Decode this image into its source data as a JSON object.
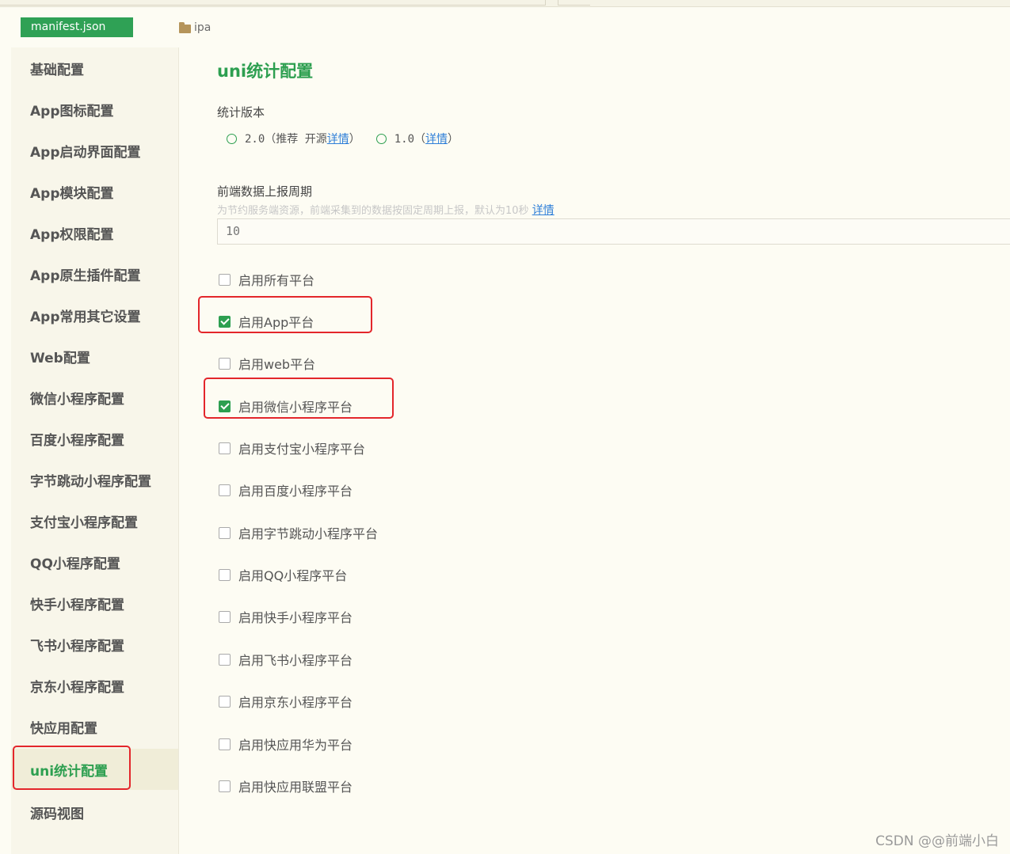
{
  "editor": {
    "file_tab": "manifest.json",
    "breadcrumb_folder": "ipa"
  },
  "sidebar": {
    "items": [
      {
        "label": "基础配置"
      },
      {
        "label": "App图标配置"
      },
      {
        "label": "App启动界面配置"
      },
      {
        "label": "App模块配置"
      },
      {
        "label": "App权限配置"
      },
      {
        "label": "App原生插件配置"
      },
      {
        "label": "App常用其它设置"
      },
      {
        "label": "Web配置"
      },
      {
        "label": "微信小程序配置"
      },
      {
        "label": "百度小程序配置"
      },
      {
        "label": "字节跳动小程序配置"
      },
      {
        "label": "支付宝小程序配置"
      },
      {
        "label": "QQ小程序配置"
      },
      {
        "label": "快手小程序配置"
      },
      {
        "label": "飞书小程序配置"
      },
      {
        "label": "京东小程序配置"
      },
      {
        "label": "快应用配置"
      },
      {
        "label": "uni统计配置"
      },
      {
        "label": "源码视图"
      }
    ],
    "active_index": 17
  },
  "main": {
    "title": "uni统计配置",
    "version": {
      "label": "统计版本",
      "opt1_text": "2.0（推荐 开源 ",
      "opt1_link": "详情",
      "opt1_close": "）",
      "opt2_text": "1.0（",
      "opt2_link": "详情",
      "opt2_close": "）"
    },
    "report": {
      "label": "前端数据上报周期",
      "hint": "为节约服务端资源，前端采集到的数据按固定周期上报，默认为10秒 ",
      "hint_link": "详情",
      "value": "10"
    },
    "platforms": [
      {
        "label": "启用所有平台",
        "checked": false
      },
      {
        "label": "启用App平台",
        "checked": true
      },
      {
        "label": "启用web平台",
        "checked": false
      },
      {
        "label": "启用微信小程序平台",
        "checked": true
      },
      {
        "label": "启用支付宝小程序平台",
        "checked": false
      },
      {
        "label": "启用百度小程序平台",
        "checked": false
      },
      {
        "label": "启用字节跳动小程序平台",
        "checked": false
      },
      {
        "label": "启用QQ小程序平台",
        "checked": false
      },
      {
        "label": "启用快手小程序平台",
        "checked": false
      },
      {
        "label": "启用飞书小程序平台",
        "checked": false
      },
      {
        "label": "启用京东小程序平台",
        "checked": false
      },
      {
        "label": "启用快应用华为平台",
        "checked": false
      },
      {
        "label": "启用快应用联盟平台",
        "checked": false
      }
    ]
  },
  "watermark": "CSDN @@前端小白",
  "colors": {
    "accent": "#2d9f50",
    "highlight": "#e3262b",
    "link": "#2f7fd8"
  }
}
